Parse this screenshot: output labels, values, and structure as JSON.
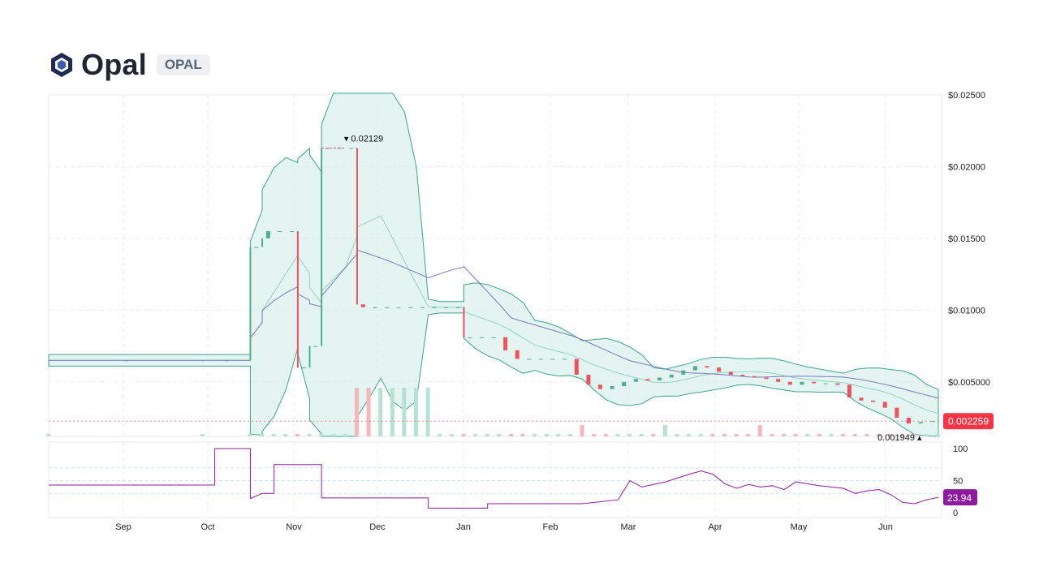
{
  "header": {
    "coin_name": "Opal",
    "ticker": "OPAL"
  },
  "colors": {
    "up": "#4cb08f",
    "down": "#e8555f",
    "band_fill": "#d9f0eb",
    "band_line": "#3aa58f",
    "ma_line": "#7b78c6",
    "rsi_line": "#8e1a9e",
    "last_price_badge": "#f23645",
    "rsi_badge": "#8e1a9e"
  },
  "chart_data": {
    "type": "candlestick",
    "price_axis": {
      "ticks": [
        0.025,
        0.02,
        0.015,
        0.01,
        0.005
      ],
      "tick_labels": [
        "$0.02500",
        "$0.02000",
        "$0.01500",
        "$0.01000",
        "$0.005000"
      ],
      "ylim": [
        0.0012,
        0.025
      ]
    },
    "time_axis": {
      "labels": [
        "Sep",
        "Oct",
        "Nov",
        "Dec",
        "Jan",
        "Feb",
        "Mar",
        "Apr",
        "May",
        "Jun"
      ]
    },
    "annotations": {
      "high_label": "0.02129",
      "high_value": 0.02129,
      "low_label": "0.001949",
      "low_value": 0.001949,
      "last_price_label": "0.002259",
      "last_price_value": 0.002259
    },
    "price_series": [
      [
        0,
        0.0065
      ],
      [
        13,
        0.0065
      ],
      [
        13,
        0.0065
      ],
      [
        17,
        0.0065
      ],
      [
        17,
        0.0144
      ],
      [
        18,
        0.0144
      ],
      [
        18,
        0.015
      ],
      [
        19,
        0.0155
      ],
      [
        20,
        0.0155
      ],
      [
        21,
        0.0155
      ],
      [
        21,
        0.006
      ],
      [
        22,
        0.006
      ],
      [
        22,
        0.0075
      ],
      [
        23,
        0.0075
      ],
      [
        23,
        0.0213
      ],
      [
        24,
        0.0213
      ],
      [
        25,
        0.0213
      ],
      [
        26,
        0.0213
      ],
      [
        26,
        0.0104
      ],
      [
        27,
        0.0102
      ],
      [
        28,
        0.0102
      ],
      [
        29,
        0.0102
      ],
      [
        30,
        0.0102
      ],
      [
        31,
        0.0102
      ],
      [
        32,
        0.0102
      ],
      [
        33,
        0.0102
      ],
      [
        34,
        0.0102
      ],
      [
        35,
        0.0102
      ],
      [
        35,
        0.0081
      ],
      [
        36,
        0.0081
      ],
      [
        37,
        0.0081
      ],
      [
        38,
        0.0081
      ],
      [
        39,
        0.0072
      ],
      [
        40,
        0.0066
      ],
      [
        41,
        0.0066
      ],
      [
        42,
        0.0066
      ],
      [
        43,
        0.0066
      ],
      [
        44,
        0.0066
      ],
      [
        45,
        0.0055
      ],
      [
        46,
        0.0048
      ],
      [
        47,
        0.0045
      ],
      [
        48,
        0.0047
      ],
      [
        49,
        0.005
      ],
      [
        50,
        0.0052
      ],
      [
        51,
        0.0051
      ],
      [
        52,
        0.0053
      ],
      [
        53,
        0.0055
      ],
      [
        54,
        0.0058
      ],
      [
        55,
        0.0061
      ],
      [
        56,
        0.006
      ],
      [
        57,
        0.0057
      ],
      [
        58,
        0.0055
      ],
      [
        59,
        0.0054
      ],
      [
        60,
        0.0053
      ],
      [
        61,
        0.0052
      ],
      [
        62,
        0.005
      ],
      [
        63,
        0.0048
      ],
      [
        64,
        0.005
      ],
      [
        65,
        0.0049
      ],
      [
        66,
        0.0049
      ],
      [
        67,
        0.0048
      ],
      [
        68,
        0.0039
      ],
      [
        69,
        0.0037
      ],
      [
        70,
        0.0036
      ],
      [
        71,
        0.0032
      ],
      [
        72,
        0.0025
      ],
      [
        73,
        0.0021
      ],
      [
        74,
        0.0022
      ],
      [
        75,
        0.002259
      ]
    ],
    "rsi": {
      "ticks": [
        100,
        50,
        0
      ],
      "tick_labels": [
        "100",
        "50",
        "0"
      ],
      "ylim": [
        0,
        100
      ],
      "guide_levels": [
        70,
        50,
        30
      ],
      "current_label": "23.94",
      "current_value": 23.94,
      "series": [
        [
          0,
          43
        ],
        [
          14,
          43
        ],
        [
          14,
          100
        ],
        [
          17,
          100
        ],
        [
          17,
          22
        ],
        [
          18,
          30
        ],
        [
          19,
          30
        ],
        [
          19,
          75
        ],
        [
          23,
          75
        ],
        [
          23,
          23
        ],
        [
          32,
          23
        ],
        [
          32,
          7
        ],
        [
          37,
          7
        ],
        [
          37,
          14
        ],
        [
          45,
          14
        ],
        [
          48,
          20
        ],
        [
          49,
          50
        ],
        [
          50,
          40
        ],
        [
          52,
          48
        ],
        [
          54,
          60
        ],
        [
          55,
          65
        ],
        [
          56,
          60
        ],
        [
          57,
          45
        ],
        [
          58,
          38
        ],
        [
          59,
          44
        ],
        [
          60,
          40
        ],
        [
          61,
          42
        ],
        [
          62,
          36
        ],
        [
          63,
          48
        ],
        [
          64,
          45
        ],
        [
          65,
          42
        ],
        [
          66,
          40
        ],
        [
          67,
          38
        ],
        [
          68,
          30
        ],
        [
          69,
          34
        ],
        [
          70,
          36
        ],
        [
          71,
          28
        ],
        [
          72,
          16
        ],
        [
          73,
          14
        ],
        [
          74,
          20
        ],
        [
          75,
          23.94
        ]
      ]
    }
  }
}
